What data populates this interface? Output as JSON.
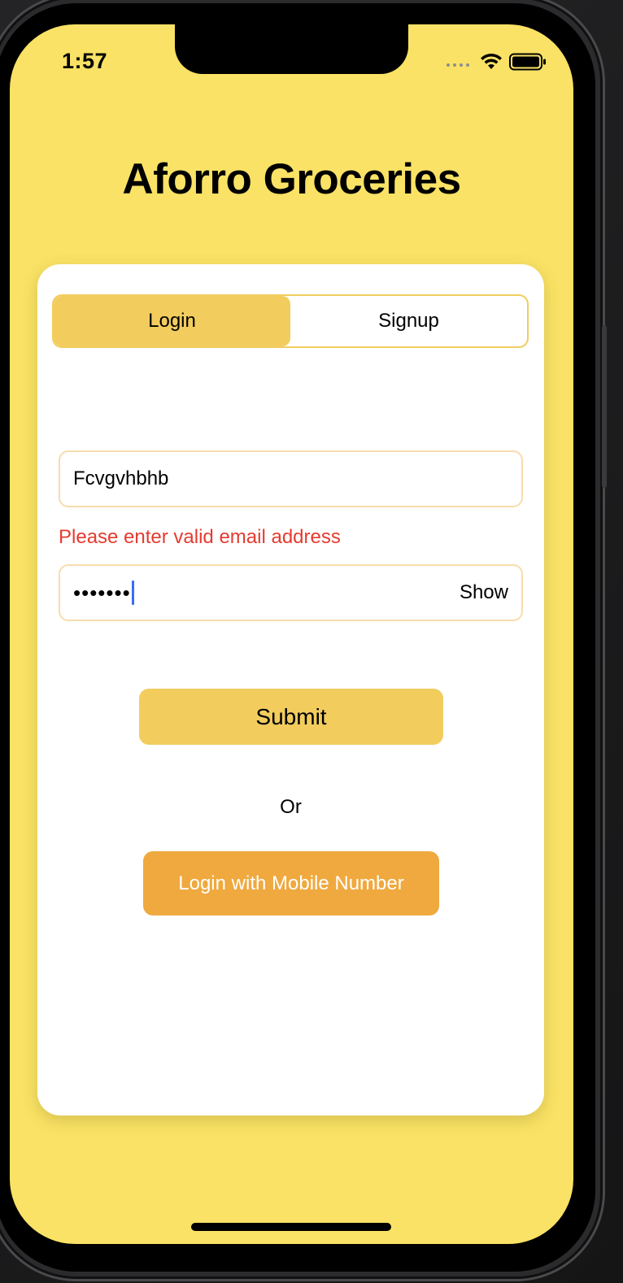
{
  "status_bar": {
    "time": "1:57"
  },
  "app": {
    "title": "Aforro Groceries"
  },
  "tabs": [
    {
      "label": "Login",
      "active": true
    },
    {
      "label": "Signup",
      "active": false
    }
  ],
  "form": {
    "email_value": "Fcvgvhbhb",
    "email_error": "Please enter valid email address",
    "password_masked": "•••••••",
    "show_label": "Show",
    "submit_label": "Submit",
    "or_label": "Or",
    "mobile_login_label": "Login with Mobile Number"
  },
  "colors": {
    "background": "#f9e265",
    "accent": "#f2cd5e",
    "secondary_button": "#f0a93e",
    "error": "#e53b30"
  },
  "icons": [
    "signal-dots-icon",
    "wifi-icon",
    "battery-icon"
  ]
}
